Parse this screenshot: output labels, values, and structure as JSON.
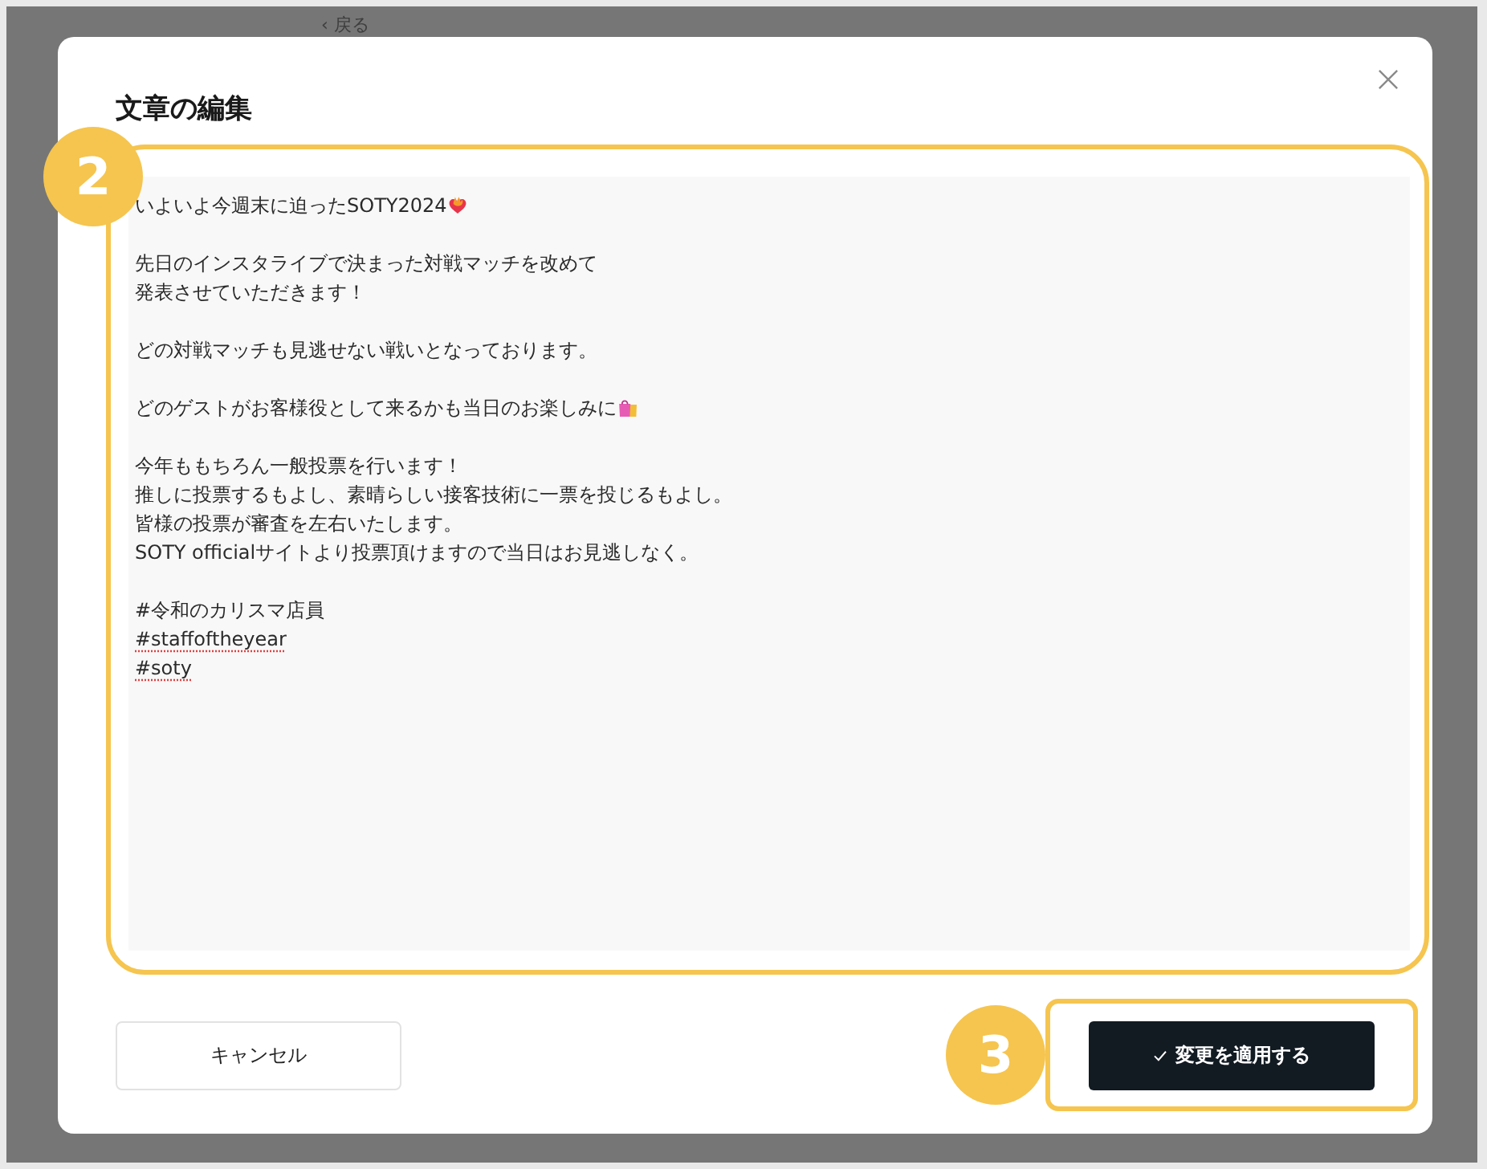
{
  "background": {
    "back_link": "‹ 戻る"
  },
  "dialog": {
    "title": "文章の編集"
  },
  "editor": {
    "step": "2",
    "paragraphs": [
      {
        "lines": [
          {
            "text": "いよいよ今週末に迫ったSOTY2024",
            "misspelled": false,
            "kind": "heart-fire"
          }
        ]
      },
      {
        "lines": [
          {
            "text": "先日のインスタライブで決まった対戦マッチを改めて",
            "misspelled": false,
            "kind": "plain"
          },
          {
            "text": "発表させていただきます！",
            "misspelled": false,
            "kind": "plain"
          }
        ]
      },
      {
        "lines": [
          {
            "text": "どの対戦マッチも見逃せない戦いとなっております。",
            "misspelled": false,
            "kind": "plain"
          }
        ]
      },
      {
        "lines": [
          {
            "text": "どのゲストがお客様役として来るかも当日のお楽しみに",
            "misspelled": false,
            "kind": "shopping-bags"
          }
        ]
      },
      {
        "lines": [
          {
            "text": "今年ももちろん一般投票を行います！",
            "misspelled": false,
            "kind": "plain"
          },
          {
            "text": "推しに投票するもよし、素晴らしい接客技術に一票を投じるもよし。",
            "misspelled": false,
            "kind": "plain"
          },
          {
            "text": "皆様の投票が審査を左右いたします。",
            "misspelled": false,
            "kind": "plain"
          },
          {
            "text": "SOTY officialサイトより投票頂けますので当日はお見逃しなく。",
            "misspelled": false,
            "kind": "plain"
          }
        ]
      },
      {
        "lines": [
          {
            "text": "#令和のカリスマ店員",
            "misspelled": false,
            "kind": "plain"
          },
          {
            "text": "#staffoftheyear",
            "misspelled": true,
            "kind": "plain"
          },
          {
            "text": "#soty",
            "misspelled": true,
            "kind": "plain"
          }
        ]
      }
    ]
  },
  "footer": {
    "step": "3",
    "cancel": "キャンセル",
    "apply": "変更を適用する"
  }
}
